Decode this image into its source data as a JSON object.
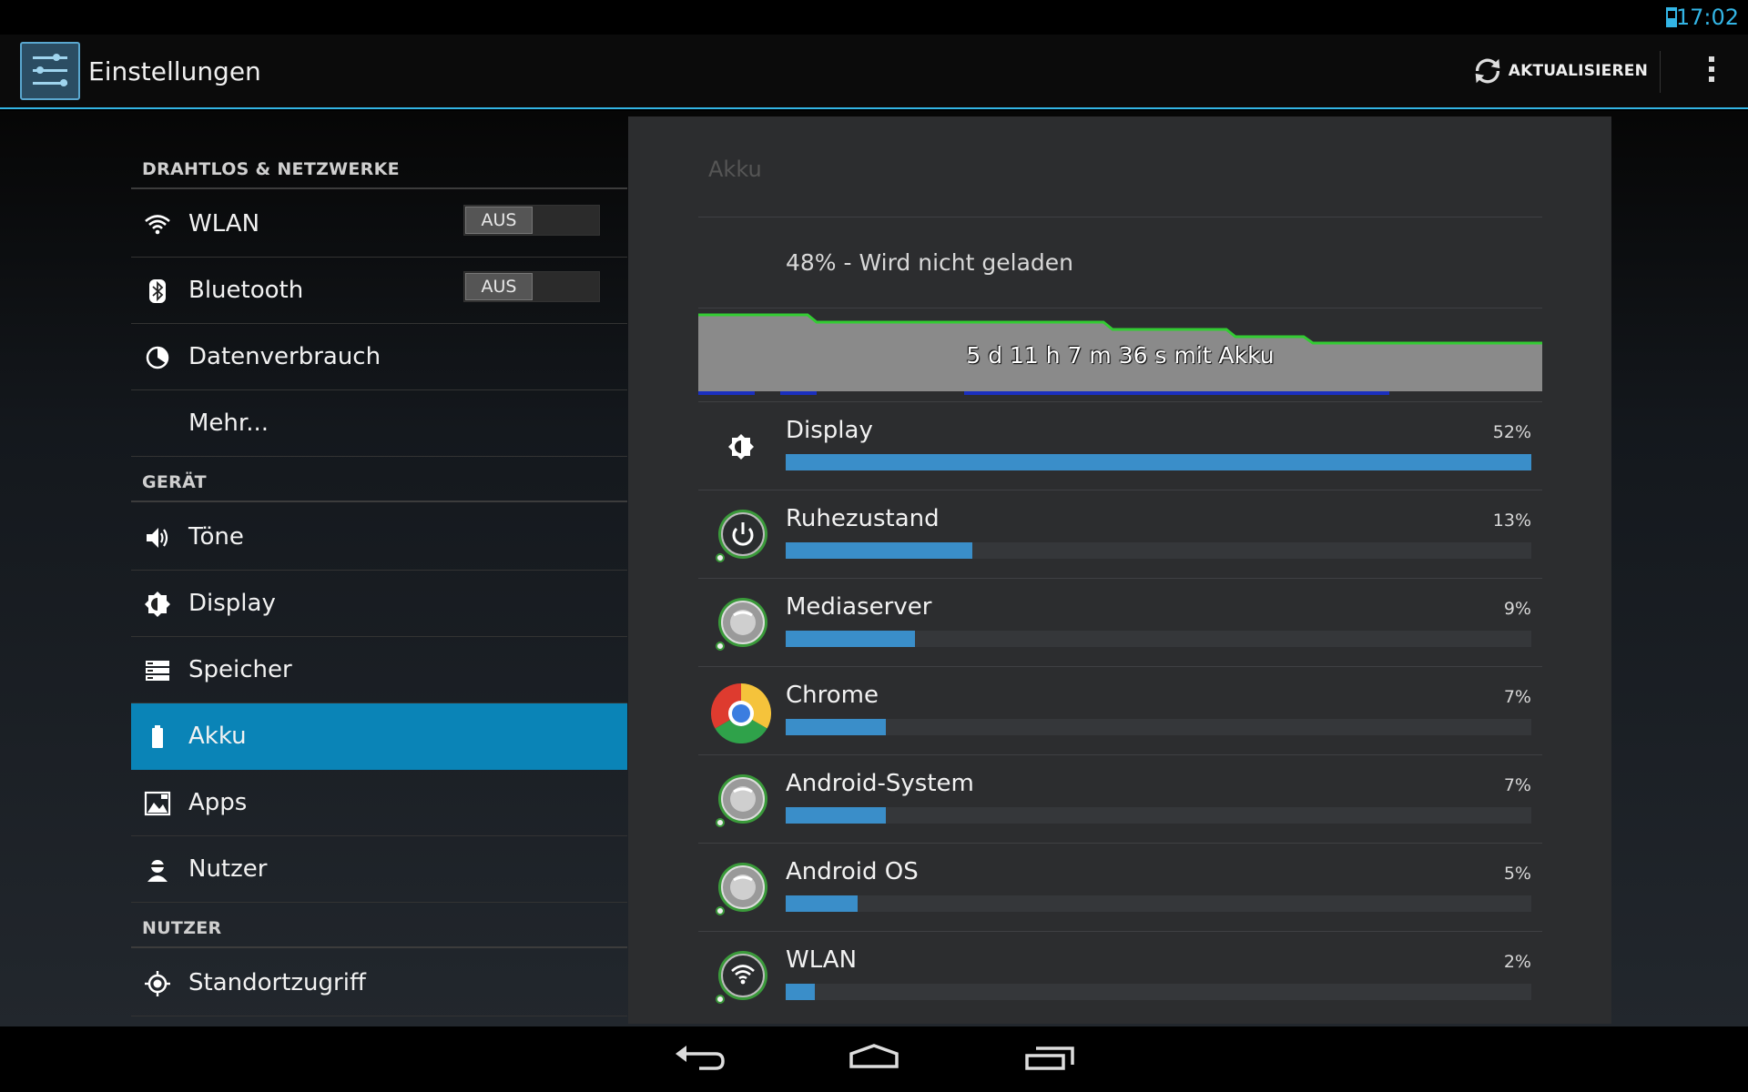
{
  "status_bar": {
    "clock": "17:02",
    "icons": [
      "battery-icon"
    ],
    "battery_level": 0.48
  },
  "action_bar": {
    "app_icon": "settings-sliders-icon",
    "title": "Einstellungen",
    "refresh_label": "AKTUALISIEREN",
    "refresh_icon": "refresh-icon",
    "overflow_icon": "overflow-menu-icon"
  },
  "sidebar": {
    "sections": [
      {
        "header": "DRAHTLOS & NETZWERKE"
      },
      {
        "header": "GERÄT"
      },
      {
        "header": "NUTZER"
      }
    ],
    "items": [
      {
        "label": "WLAN",
        "icon": "wifi-icon",
        "toggle": "AUS"
      },
      {
        "label": "Bluetooth",
        "icon": "bluetooth-icon",
        "toggle": "AUS"
      },
      {
        "label": "Datenverbrauch",
        "icon": "data-usage-icon"
      },
      {
        "label": "Mehr...",
        "icon": ""
      },
      {
        "label": "Töne",
        "icon": "volume-icon"
      },
      {
        "label": "Display",
        "icon": "brightness-icon"
      },
      {
        "label": "Speicher",
        "icon": "storage-icon"
      },
      {
        "label": "Akku",
        "icon": "battery-icon",
        "selected": true
      },
      {
        "label": "Apps",
        "icon": "apps-icon"
      },
      {
        "label": "Nutzer",
        "icon": "user-icon"
      },
      {
        "label": "Standortzugriff",
        "icon": "location-icon"
      }
    ]
  },
  "battery": {
    "title": "Akku",
    "status": "48% - Wird nicht geladen",
    "graph_label": "5 d 11 h 7 m 36 s mit Akku",
    "colors": {
      "graph_fill": "#8a8a8a",
      "graph_line": "#33cc33",
      "usage_bar": "#3a8ec9",
      "awake": "#1a2fbf"
    },
    "usage": [
      {
        "name": "Display",
        "percent": "52%",
        "value": 52,
        "icon": "brightness-icon"
      },
      {
        "name": "Ruhezustand",
        "percent": "13%",
        "value": 13,
        "icon": "power-icon"
      },
      {
        "name": "Mediaserver",
        "percent": "9%",
        "value": 9,
        "icon": "android-system-icon"
      },
      {
        "name": "Chrome",
        "percent": "7%",
        "value": 7,
        "icon": "chrome-icon"
      },
      {
        "name": "Android-System",
        "percent": "7%",
        "value": 7,
        "icon": "android-system-icon"
      },
      {
        "name": "Android OS",
        "percent": "5%",
        "value": 5,
        "icon": "android-system-icon"
      },
      {
        "name": "WLAN",
        "percent": "2%",
        "value": 2,
        "icon": "wifi-icon"
      }
    ]
  },
  "navigation": {
    "buttons": [
      "back-icon",
      "home-icon",
      "recent-apps-icon"
    ]
  }
}
